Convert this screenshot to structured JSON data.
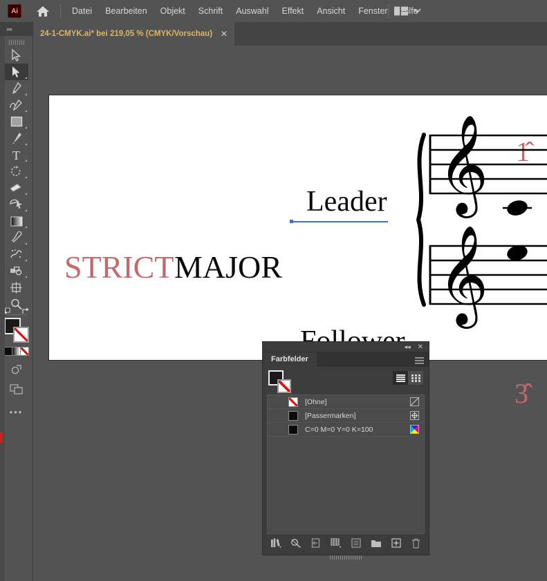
{
  "app": {
    "name": "Ai",
    "logo_color": "#330000",
    "accent_text": "#dcb56d"
  },
  "menubar": {
    "items": [
      {
        "label": "Datei"
      },
      {
        "label": "Bearbeiten"
      },
      {
        "label": "Objekt"
      },
      {
        "label": "Schrift"
      },
      {
        "label": "Auswahl"
      },
      {
        "label": "Effekt"
      },
      {
        "label": "Ansicht"
      },
      {
        "label": "Fenster"
      },
      {
        "label": "Hilfe"
      }
    ],
    "home_icon": "home-icon",
    "arrange_icon": "arrange-documents-icon",
    "arrange_chevron": "chevron-down-icon"
  },
  "tabbar": {
    "document_title": "24-1-CMYK.ai* bei 219,05 % (CMYK/Vorschau)",
    "close_label": "✕",
    "dock_collapse": "»»"
  },
  "toolbar": {
    "tools": [
      {
        "name": "selection-tool",
        "label": "Auswahl",
        "selected": false,
        "has_flyout": false
      },
      {
        "name": "direct-selection-tool",
        "label": "Direktauswahl",
        "selected": true,
        "has_flyout": true
      },
      {
        "name": "pen-tool",
        "label": "Zeichenstift",
        "selected": false,
        "has_flyout": true
      },
      {
        "name": "curvature-tool",
        "label": "Krümmung",
        "selected": false,
        "has_flyout": true
      },
      {
        "name": "rectangle-tool",
        "label": "Rechteck",
        "selected": false,
        "has_flyout": true
      },
      {
        "name": "paintbrush-tool",
        "label": "Pinsel",
        "selected": false,
        "has_flyout": true
      },
      {
        "name": "type-tool",
        "label": "Text",
        "selected": false,
        "has_flyout": true
      },
      {
        "name": "rotate-tool",
        "label": "Drehen",
        "selected": false,
        "has_flyout": true
      },
      {
        "name": "eraser-tool",
        "label": "Radiergummi",
        "selected": false,
        "has_flyout": true
      },
      {
        "name": "shape-builder-tool",
        "label": "Formerstellung",
        "selected": false,
        "has_flyout": true
      },
      {
        "name": "gradient-tool",
        "label": "Verlauf",
        "selected": false,
        "has_flyout": true
      },
      {
        "name": "eyedropper-tool",
        "label": "Pipette",
        "selected": false,
        "has_flyout": true
      },
      {
        "name": "symbol-sprayer-tool",
        "label": "Symbol aufsprühen",
        "selected": false,
        "has_flyout": true
      },
      {
        "name": "free-transform-tool",
        "label": "Frei transformieren",
        "selected": false,
        "has_flyout": true
      },
      {
        "name": "artboard-tool",
        "label": "Zeichenfläche",
        "selected": false,
        "has_flyout": false
      },
      {
        "name": "zoom-tool",
        "label": "Zoom",
        "selected": false,
        "has_flyout": false
      }
    ],
    "fill_color": "#1a1a1a",
    "stroke_color": "none",
    "gradient_row": [
      "color",
      "gradient",
      "none"
    ],
    "more_tools": "•••"
  },
  "artboard": {
    "texts": [
      {
        "name": "strict-text",
        "content": "STRICT",
        "color": "#c4696d"
      },
      {
        "name": "major-text",
        "content": "MAJOR",
        "color": "#0a0a0a"
      },
      {
        "name": "leader-text",
        "content": "Leader",
        "color": "#0a0a0a"
      },
      {
        "name": "follower-text",
        "content": "Follower",
        "color": "#0a0a0a"
      }
    ],
    "scale_degrees": [
      {
        "name": "scale-degree-1",
        "content": "1̂",
        "color": "#c4696d"
      },
      {
        "name": "scale-degree-3",
        "content": "3̂",
        "color": "#c4696d"
      }
    ],
    "selection_color": "#3b6bdb",
    "music": {
      "systems": 2,
      "clef": "treble-clef",
      "brace": "brace-icon",
      "notes": [
        {
          "name": "whole-note-upper",
          "ledger_line": true
        },
        {
          "name": "whole-note-lower",
          "ledger_line": false
        }
      ]
    }
  },
  "panel": {
    "tab_label": "Farbfelder",
    "collapse_icon": "◂◂",
    "close_icon": "✕",
    "menu_icon": "panel-menu-icon",
    "fill_color": "#1a1a1a",
    "stroke_color": "none",
    "view_modes": [
      {
        "name": "list-view-button",
        "active": true
      },
      {
        "name": "grid-view-button",
        "active": false
      }
    ],
    "swatches": [
      {
        "label": "[Ohne]",
        "chip": "none",
        "kind": "none-icon"
      },
      {
        "label": "[Passermarken]",
        "chip": "black",
        "kind": "registration-icon"
      },
      {
        "label": "C=0 M=0 Y=0 K=100",
        "chip": "black",
        "kind": "cmyk-icon"
      }
    ],
    "footer_buttons": [
      {
        "name": "swatch-libraries-button"
      },
      {
        "name": "show-swatch-kinds-button"
      },
      {
        "name": "add-to-library-button"
      },
      {
        "name": "swatch-options-grid-button"
      },
      {
        "name": "swatch-options-button"
      },
      {
        "name": "new-color-group-button"
      },
      {
        "name": "new-swatch-button"
      },
      {
        "name": "delete-swatch-button"
      }
    ]
  },
  "colors": {
    "ui_background": "#535353",
    "panel_background": "#3c3c3c",
    "list_background": "#4b4b4b",
    "accent_rose": "#c4696d",
    "selection_blue": "#3b6bdb",
    "tab_title": "#dcb56d"
  }
}
